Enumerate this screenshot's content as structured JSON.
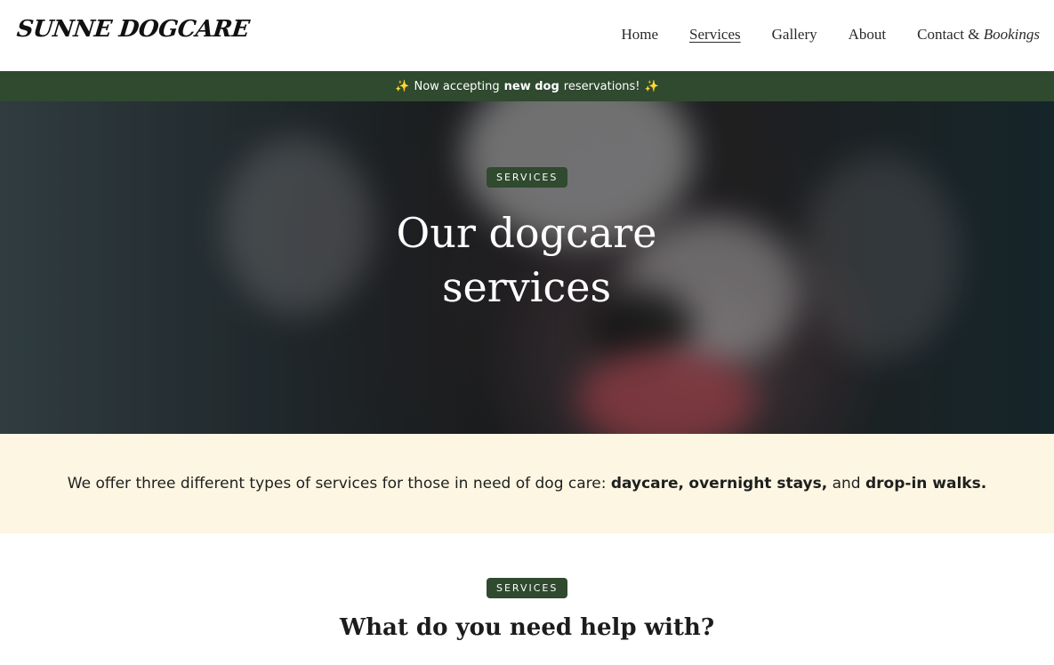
{
  "header": {
    "logo": "Sunne Dogcare",
    "nav": [
      {
        "label": "Home"
      },
      {
        "label": "Services"
      },
      {
        "label": "Gallery"
      },
      {
        "label": "About"
      },
      {
        "label_prefix": "Contact & ",
        "label_italic": "Bookings"
      }
    ],
    "active_nav": "Services"
  },
  "announcement": {
    "left_icon": "sparkle-icon",
    "text_before": "Now accepting",
    "text_bold": "new dog",
    "text_after": "reservations!",
    "right_icon": "sparkle-icon"
  },
  "hero": {
    "badge": "SERVICES",
    "title_line1": "Our dogcare",
    "title_line2": "services"
  },
  "intro": {
    "text": "We offer three different types of services for those in need of dog care:",
    "service1": "daycare,",
    "service2": "overnight stays,",
    "and": "and",
    "service3": "drop-in walks."
  },
  "services": {
    "badge": "SERVICES",
    "heading": "What do you need help with?"
  },
  "colors": {
    "brand_green": "#2f4a2e",
    "cream": "#fdf6e2"
  }
}
